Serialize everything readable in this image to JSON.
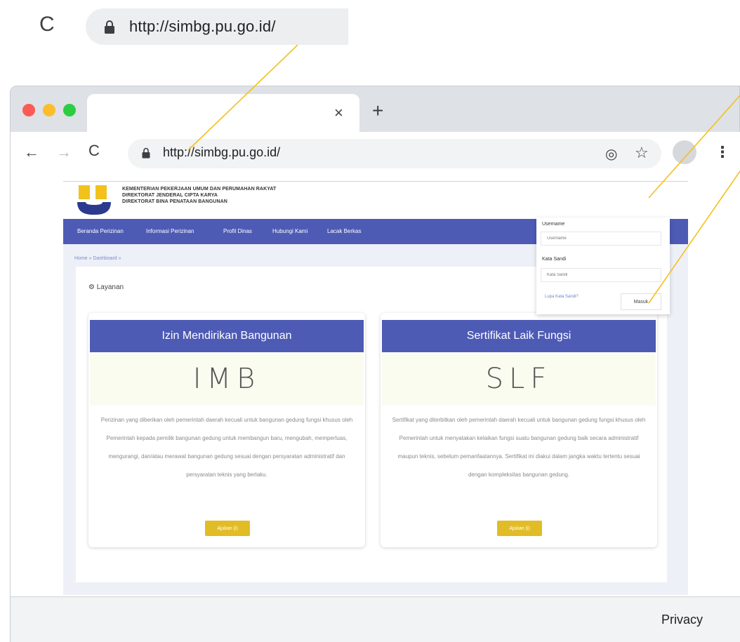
{
  "zoom_address": {
    "url": "http://simbg.pu.go.id/"
  },
  "browser": {
    "tab_close": "×",
    "new_tab": "+",
    "url": "http://simbg.pu.go.id/",
    "back": "←",
    "forward": "→",
    "reload": "C",
    "location_icon": "◎",
    "star_icon": "☆",
    "menu_icon": "⋮",
    "status_privacy": "Privacy"
  },
  "site": {
    "org_lines": [
      "KEMENTERIAN PEKERJAAN UMUM DAN PERUMAHAN RAKYAT",
      "DIREKTORAT JENDERAL CIPTA KARYA",
      "DIREKTORAT BINA PENATAAN BANGUNAN"
    ],
    "header_links": {
      "register": "",
      "login": ""
    },
    "nav": [
      "Beranda Perizinan",
      "Informasi Perizinan",
      "Profil Dinas",
      "Hubungi Kami",
      "Lacak Berkas"
    ],
    "breadcrumb": "Home » Dashboard »",
    "section_title": "Layanan",
    "services": [
      {
        "title": "Izin Mendirikan Bangunan",
        "code": "IMB",
        "description": "Perizinan yang diberikan oleh pemerintah daerah kecuali untuk bangunan gedung fungsi khusus oleh Pemerintah kepada pemilik bangunan gedung untuk membangun baru, mengubah, memperluas, mengurangi, dan/atau merawat bangunan gedung sesuai dengan persyaratan administratif dan persyaratan teknis yang berlaku.",
        "button": "Ajukan (i)"
      },
      {
        "title": "Sertifikat Laik Fungsi",
        "code": "SLF",
        "description": "Sertifikat yang diterbitkan oleh pemerintah daerah kecuali untuk bangunan gedung fungsi khusus oleh Pemerintah untuk menyatakan kelaikan fungsi suatu bangunan gedung baik secara administratif maupun teknis, sebelum pemanfaatannya. Sertifikat ini diakui dalam jangka waktu tertentu sesuai dengan kompleksitas bangunan gedung.",
        "button": "Ajukan (i)"
      }
    ],
    "login_panel": {
      "username_label": "Username",
      "username_placeholder": "Username",
      "password_label": "Kata Sandi",
      "password_placeholder": "Kata Sandi",
      "forgot": "Lupa Kata Sandi?",
      "submit": "Masuk"
    }
  },
  "colors": {
    "nav_blue": "#4d5bb5",
    "button_gold": "#e2bc26",
    "callout_gold": "#f2c21b"
  }
}
